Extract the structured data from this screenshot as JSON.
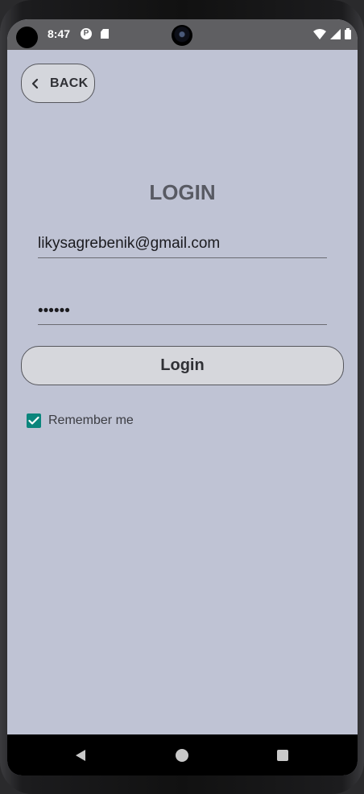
{
  "status_bar": {
    "time": "8:47",
    "left_icons": [
      "p-icon",
      "sd-card-icon"
    ],
    "right_icons": [
      "wifi-icon",
      "signal-icon",
      "battery-icon"
    ]
  },
  "back_button": {
    "label": "BACK",
    "icon": "chevron-left-icon"
  },
  "page": {
    "title": "LOGIN"
  },
  "form": {
    "email_value": "likysagrebenik@gmail.com",
    "password_value": "••••••",
    "login_label": "Login",
    "remember_label": "Remember me",
    "remember_checked": true
  },
  "nav_bar": {
    "icons": [
      "back-triangle-icon",
      "home-circle-icon",
      "recents-square-icon"
    ]
  },
  "colors": {
    "screen_bg": "#bfc3d4",
    "status_bar_bg": "#5f5f62",
    "checkbox_accent": "#0b857c",
    "button_bg": "#d6d7dc"
  }
}
